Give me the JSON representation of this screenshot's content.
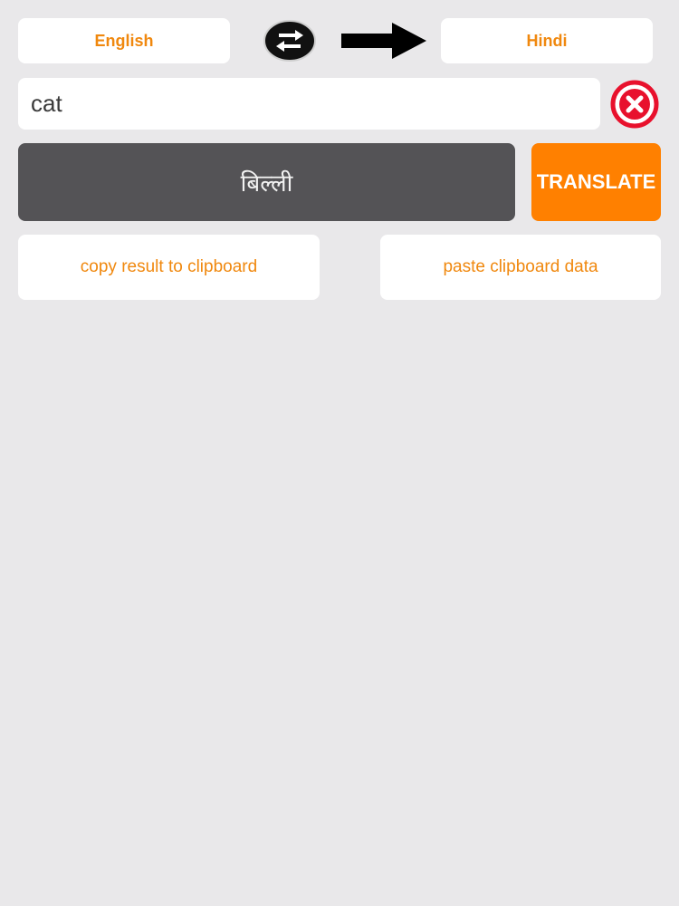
{
  "languages": {
    "source": "English",
    "target": "Hindi"
  },
  "icons": {
    "swap": "swap-arrows-icon",
    "direction": "right-arrow-icon",
    "clear": "clear-x-icon"
  },
  "input": {
    "value": "cat"
  },
  "result": {
    "text": "बिल्ली"
  },
  "buttons": {
    "translate": "TRANSLATE",
    "copy": "copy result to clipboard",
    "paste": "paste clipboard data"
  },
  "colors": {
    "background": "#e9e8ea",
    "accent_orange": "#ff8000",
    "label_orange": "#f0880e",
    "result_bg": "#545356",
    "clear_red": "#e8112d"
  }
}
